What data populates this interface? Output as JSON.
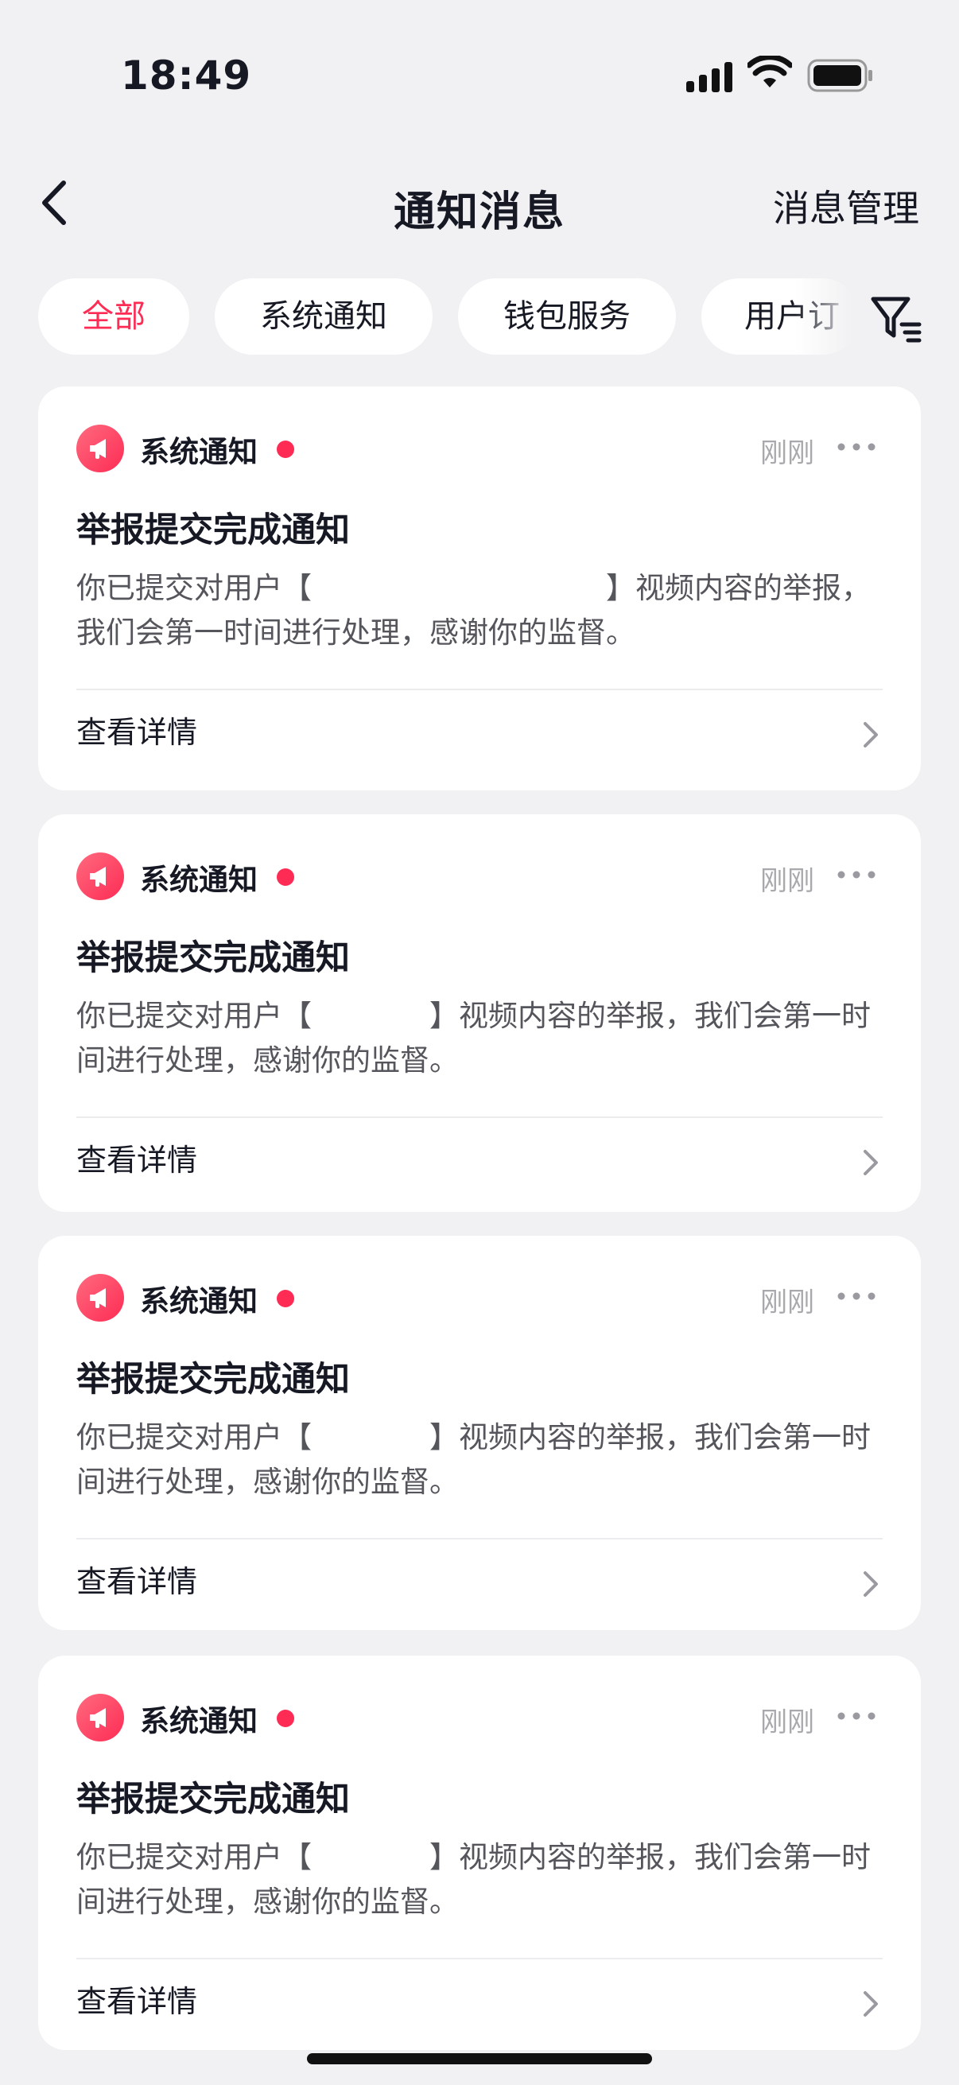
{
  "status_bar": {
    "time": "18:49",
    "icons": [
      "signal-icon",
      "wifi-icon",
      "battery-icon"
    ]
  },
  "nav": {
    "title": "通知消息",
    "manage_label": "消息管理",
    "back_icon": "chevron-left-icon"
  },
  "tabs": [
    {
      "label": "全部",
      "active": true
    },
    {
      "label": "系统通知",
      "active": false
    },
    {
      "label": "钱包服务",
      "active": false
    },
    {
      "label": "用户订",
      "active": false
    }
  ],
  "filter_icon": "filter-icon",
  "colors": {
    "accent": "#fe2c55",
    "background": "#f1f1f3",
    "card": "#ffffff",
    "muted_text": "#a8a8ad",
    "body_text": "#55565c"
  },
  "notifications": [
    {
      "source": "系统通知",
      "time": "刚刚",
      "title": "举报提交完成通知",
      "body": "你已提交对用户【　　　　　　　　　　】视频内容的举报，我们会第一时间进行处理，感谢你的监督。",
      "action": "查看详情"
    },
    {
      "source": "系统通知",
      "time": "刚刚",
      "title": "举报提交完成通知",
      "body": "你已提交对用户【　　　　】视频内容的举报，我们会第一时间进行处理，感谢你的监督。",
      "action": "查看详情"
    },
    {
      "source": "系统通知",
      "time": "刚刚",
      "title": "举报提交完成通知",
      "body": "你已提交对用户【　　　　】视频内容的举报，我们会第一时间进行处理，感谢你的监督。",
      "action": "查看详情"
    },
    {
      "source": "系统通知",
      "time": "刚刚",
      "title": "举报提交完成通知",
      "body": "你已提交对用户【　　　　】视频内容的举报，我们会第一时间进行处理，感谢你的监督。",
      "action": "查看详情"
    }
  ]
}
